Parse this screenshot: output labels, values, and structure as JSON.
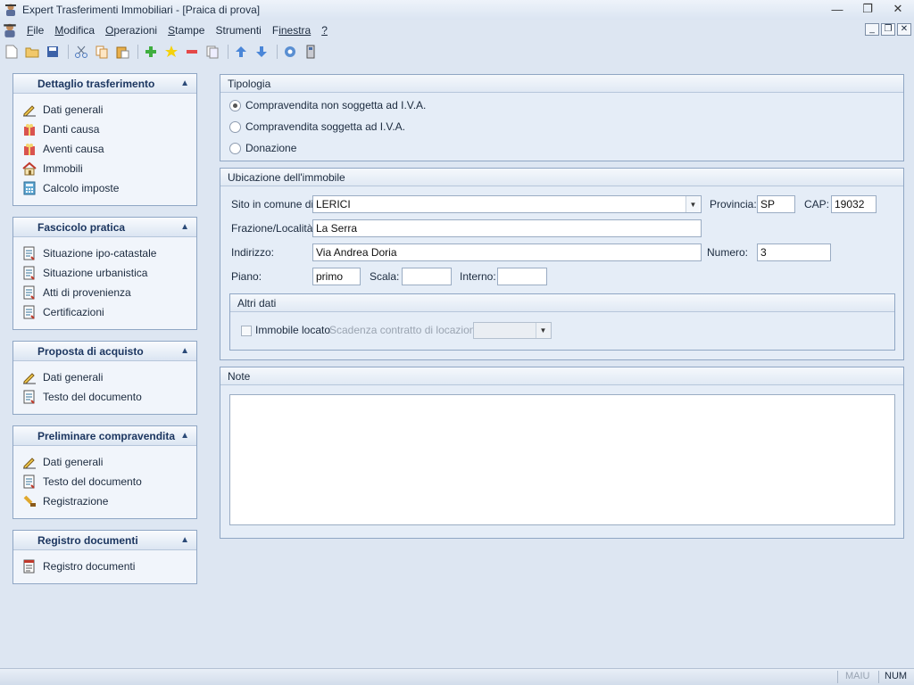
{
  "window": {
    "title": "Expert Trasferimenti Immobiliari - [Praica di prova]"
  },
  "menu": {
    "items": [
      {
        "label": "File",
        "key": "F",
        "rest": "ile"
      },
      {
        "label": "Modifica",
        "key": "M",
        "rest": "odifica"
      },
      {
        "label": "Operazioni",
        "key": "O",
        "rest": "perazioni"
      },
      {
        "label": "Stampe",
        "key": "S",
        "rest": "tampe"
      },
      {
        "label": "Strumenti",
        "key": "S",
        "rest": "trumenti"
      },
      {
        "label": "Finestra",
        "key": "F",
        "rest": "inestra"
      },
      {
        "label": "?",
        "key": "?",
        "rest": ""
      }
    ]
  },
  "toolbar": {
    "buttons": [
      "new-icon",
      "open-icon",
      "save-icon",
      "cut-icon",
      "copy-icon",
      "paste-icon",
      "add-icon",
      "star-icon",
      "remove-icon",
      "duplicate-icon",
      "arrow-up-icon",
      "arrow-down-icon",
      "help-icon",
      "info-icon"
    ]
  },
  "sidebar": {
    "panels": [
      {
        "title": "Dettaglio trasferimento",
        "items": [
          {
            "label": "Dati generali",
            "icon": "pen-icon"
          },
          {
            "label": "Danti causa",
            "icon": "gift-icon"
          },
          {
            "label": "Aventi causa",
            "icon": "gift-icon"
          },
          {
            "label": "Immobili",
            "icon": "house-icon"
          },
          {
            "label": "Calcolo imposte",
            "icon": "calculator-icon"
          }
        ]
      },
      {
        "title": "Fascicolo pratica",
        "items": [
          {
            "label": "Situazione ipo-catastale",
            "icon": "document-icon"
          },
          {
            "label": "Situazione urbanistica",
            "icon": "document-icon"
          },
          {
            "label": "Atti di provenienza",
            "icon": "document-icon"
          },
          {
            "label": "Certificazioni",
            "icon": "document-icon"
          }
        ]
      },
      {
        "title": "Proposta di acquisto",
        "items": [
          {
            "label": "Dati generali",
            "icon": "pen-icon"
          },
          {
            "label": "Testo del documento",
            "icon": "document-icon"
          }
        ]
      },
      {
        "title": "Preliminare compravendita",
        "items": [
          {
            "label": "Dati generali",
            "icon": "pen-icon"
          },
          {
            "label": "Testo del documento",
            "icon": "document-icon"
          },
          {
            "label": "Registrazione",
            "icon": "stamp-icon"
          }
        ]
      },
      {
        "title": "Registro documenti",
        "items": [
          {
            "label": "Registro documenti",
            "icon": "register-icon"
          }
        ]
      }
    ]
  },
  "tipologia": {
    "title": "Tipologia",
    "options": [
      {
        "label": "Compravendita non soggetta ad I.V.A.",
        "selected": true
      },
      {
        "label": "Compravendita soggetta ad I.V.A.",
        "selected": false
      },
      {
        "label": "Donazione",
        "selected": false
      }
    ]
  },
  "ubicazione": {
    "title": "Ubicazione dell'immobile",
    "comune_label": "Sito in comune di:",
    "comune_value": "LERICI",
    "provincia_label": "Provincia:",
    "provincia_value": "SP",
    "cap_label": "CAP:",
    "cap_value": "19032",
    "frazione_label": "Frazione/Località:",
    "frazione_value": "La Serra",
    "indirizzo_label": "Indirizzo:",
    "indirizzo_value": "Via Andrea Doria",
    "numero_label": "Numero:",
    "numero_value": "3",
    "piano_label": "Piano:",
    "piano_value": "primo",
    "scala_label": "Scala:",
    "scala_value": "",
    "interno_label": "Interno:",
    "interno_value": "",
    "altri_dati": {
      "title": "Altri dati",
      "locato_label": "Immobile locato",
      "locato_checked": false,
      "scadenza_label": "Scadenza contratto di locazione:",
      "scadenza_value": ""
    }
  },
  "note": {
    "title": "Note",
    "value": ""
  },
  "statusbar": {
    "maiu": "MAIU",
    "num": "NUM"
  }
}
